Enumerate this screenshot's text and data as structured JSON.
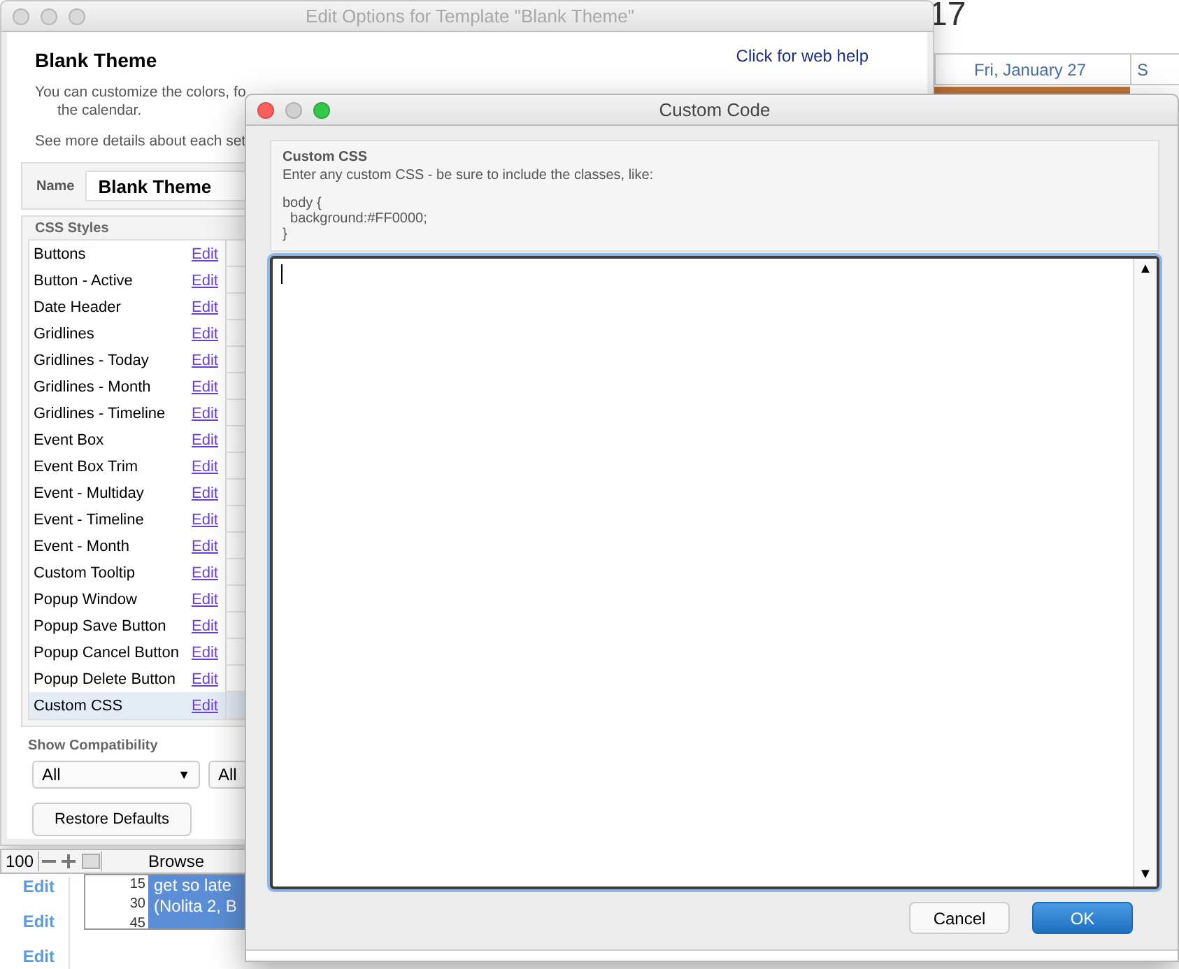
{
  "background_app": {
    "date_number": "17",
    "day_headers": [
      "Fri, January 27",
      "S"
    ],
    "status_bar": {
      "zoom": "100",
      "mode": "Browse"
    },
    "edit_links": [
      "Edit",
      "Edit",
      "Edit"
    ],
    "time_slots": [
      "15",
      "30",
      "45"
    ],
    "event_lines": [
      "get so late",
      "(Nolita 2, B"
    ]
  },
  "options_window": {
    "title": "Edit Options for Template \"Blank Theme\"",
    "heading": "Blank Theme",
    "help_link": "Click for web help",
    "intro": [
      "You can customize the colors, fo",
      "the calendar."
    ],
    "details": "See more details about each set",
    "name_label": "Name",
    "name_value": "Blank Theme",
    "styles_label": "CSS Styles",
    "styles": [
      {
        "name": "Buttons",
        "action": "Edit",
        "selected": false
      },
      {
        "name": "Button - Active",
        "action": "Edit",
        "selected": false
      },
      {
        "name": "Date Header",
        "action": "Edit",
        "selected": false
      },
      {
        "name": "Gridlines",
        "action": "Edit",
        "selected": false
      },
      {
        "name": "Gridlines - Today",
        "action": "Edit",
        "selected": false
      },
      {
        "name": "Gridlines - Month",
        "action": "Edit",
        "selected": false
      },
      {
        "name": "Gridlines - Timeline",
        "action": "Edit",
        "selected": false
      },
      {
        "name": "Event Box",
        "action": "Edit",
        "selected": false
      },
      {
        "name": "Event Box Trim",
        "action": "Edit",
        "selected": false
      },
      {
        "name": "Event - Multiday",
        "action": "Edit",
        "selected": false
      },
      {
        "name": "Event - Timeline",
        "action": "Edit",
        "selected": false
      },
      {
        "name": "Event - Month",
        "action": "Edit",
        "selected": false
      },
      {
        "name": "Custom Tooltip",
        "action": "Edit",
        "selected": false
      },
      {
        "name": "Popup Window",
        "action": "Edit",
        "selected": false
      },
      {
        "name": "Popup Save Button",
        "action": "Edit",
        "selected": false
      },
      {
        "name": "Popup Cancel Button",
        "action": "Edit",
        "selected": false
      },
      {
        "name": "Popup Delete Button",
        "action": "Edit",
        "selected": false
      },
      {
        "name": "Custom CSS",
        "action": "Edit",
        "selected": true
      }
    ],
    "compat_label": "Show Compatibility",
    "compat_selects": [
      {
        "value": "All",
        "arrow": "▼"
      },
      {
        "value": "All"
      }
    ],
    "restore_button": "Restore Defaults"
  },
  "dialog": {
    "title": "Custom Code",
    "info_title": "Custom CSS",
    "info_text": "Enter any custom CSS - be sure to include the classes, like:",
    "example": [
      "body {",
      "  background:#FF0000;",
      "}"
    ],
    "scroll_up": "▲",
    "scroll_down": "▼",
    "buttons": [
      {
        "label": "Cancel",
        "primary": false
      },
      {
        "label": "OK",
        "primary": true
      }
    ]
  }
}
